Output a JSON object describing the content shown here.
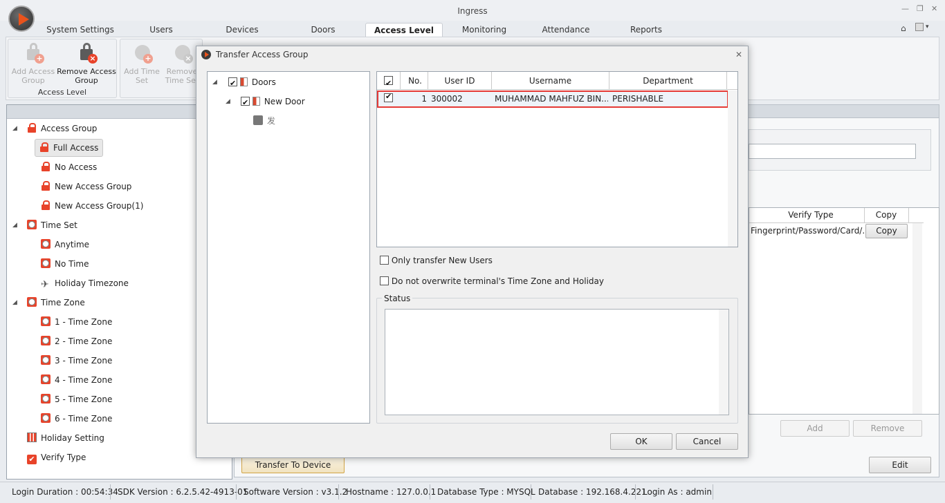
{
  "window": {
    "title": "Ingress",
    "min": "—",
    "restore": "❐",
    "close": "✕",
    "help_icon": "⌂",
    "help_caret": "▾"
  },
  "tabs": [
    "System Settings",
    "Users",
    "Devices",
    "Doors",
    "Access Level",
    "Monitoring",
    "Attendance",
    "Reports"
  ],
  "active_tab": "Access Level",
  "ribbon": {
    "add_access_group": "Add Access Group",
    "remove_access_group": "Remove Access Group",
    "group_label": "Access Level",
    "add_time_set": "Add Time Set",
    "remove_time_set": "Remove Time Set"
  },
  "tree": {
    "access_group": "Access Group",
    "full_access": "Full Access",
    "no_access": "No Access",
    "new_access_group": "New Access Group",
    "new_access_group_1": "New Access Group(1)",
    "time_set": "Time Set",
    "anytime": "Anytime",
    "no_time": "No Time",
    "holiday_timezone": "Holiday Timezone",
    "time_zone": "Time Zone",
    "tz1": "1 - Time Zone",
    "tz2": "2 - Time Zone",
    "tz3": "3 - Time Zone",
    "tz4": "4 - Time Zone",
    "tz5": "5 - Time Zone",
    "tz6": "6 - Time Zone",
    "holiday_setting": "Holiday Setting",
    "verify_type": "Verify Type"
  },
  "right_panel": {
    "col_verify_type": "Verify Type",
    "col_copy": "Copy",
    "row_verify": "Fingerprint/Password/Card/...",
    "row_copy": "Copy",
    "add": "Add",
    "remove": "Remove",
    "edit": "Edit",
    "transfer_to_device": "Transfer To Device"
  },
  "dialog": {
    "title": "Transfer Access Group",
    "close": "✕",
    "door_tree": {
      "doors": "Doors",
      "new_door": "New Door",
      "device": "发"
    },
    "grid": {
      "headers": {
        "no": "No.",
        "user_id": "User ID",
        "username": "Username",
        "department": "Department"
      },
      "rows": [
        {
          "no": "1",
          "user_id": "300002",
          "username": "MUHAMMAD MAHFUZ BIN...",
          "department": "PERISHABLE"
        }
      ]
    },
    "only_new_users": "Only transfer New Users",
    "no_overwrite": "Do not overwrite terminal's Time Zone and Holiday",
    "status_label": "Status",
    "ok": "OK",
    "cancel": "Cancel"
  },
  "statusbar": {
    "login_duration": "Login Duration : 00:54:34",
    "sdk_version": "SDK Version : 6.2.5.42-4913-01",
    "software_version": "Software Version : v3.1.2",
    "hostname": "Hostname : 127.0.0.1",
    "database_type": "Database Type : MYSQL",
    "database": "Database : 192.168.4.221",
    "login_as": "Login As : admin"
  },
  "colors": {
    "accent": "#e8432a",
    "highlight": "#e53935"
  }
}
